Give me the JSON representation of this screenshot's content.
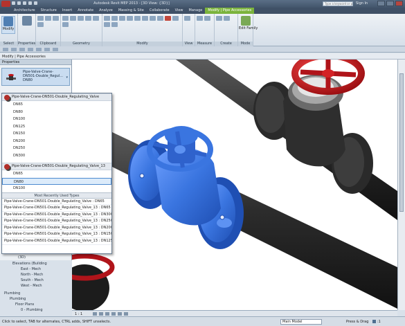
{
  "window": {
    "title": "Autodesk Revit MEP 2013 - [3D View: {3D}]",
    "help_search_placeholder": "Type a keyword or phrase",
    "signin_label": "Sign In"
  },
  "ribbon_tabs": [
    "Architecture",
    "Structure",
    "Insert",
    "Annotate",
    "Analyze",
    "Massing & Site",
    "Collaborate",
    "View",
    "Manage",
    "Modify | Pipe Accessories"
  ],
  "ribbon_panels": {
    "select": "Select",
    "properties": "Properties",
    "clipboard": "Clipboard",
    "geometry": "Geometry",
    "modify": "Modify",
    "view": "View",
    "measure": "Measure",
    "create": "Create",
    "mode": "Mode",
    "modify_button": "Modify",
    "edit_family_button": "Edit Family"
  },
  "context_label": "Modify | Pipe Accessories",
  "properties": {
    "header": "Properties",
    "type_selector": "Pipe-Valve-Crane-DN501-Double_Regul... DN80",
    "dropdown_arrow": "▾"
  },
  "type_dropdown": {
    "families": [
      {
        "name": "Pipe-Valve-Crane-DN501-Double_Regulating_Valve",
        "sizes": [
          "DN65",
          "DN80",
          "DN100",
          "DN125",
          "DN150",
          "DN200",
          "DN250",
          "DN300"
        ]
      },
      {
        "name": "Pipe-Valve-Crane-DN501-Double_Regulating_Valve_13",
        "sizes": [
          "DN65",
          "DN80",
          "DN100"
        ]
      }
    ],
    "mru_header": "Most Recently Used Types",
    "mru_items": [
      "Pipe-Valve-Crane-DN501-Double_Regulating_Valve : DN65",
      "Pipe-Valve-Crane-DN501-Double_Regulating_Valve_13 : DN65",
      "Pipe-Valve-Crane-DN501-Double_Regulating_Valve_13 : DN300",
      "Pipe-Valve-Crane-DN501-Double_Regulating_Valve_13 : DN250",
      "Pipe-Valve-Crane-DN501-Double_Regulating_Valve_13 : DN200",
      "Pipe-Valve-Crane-DN501-Double_Regulating_Valve_13 : DN150",
      "Pipe-Valve-Crane-DN501-Double_Regulating_Valve_13 : DN125"
    ]
  },
  "browser_tree": {
    "items": [
      "(3D)",
      "Elevations (Building",
      "East - Mech",
      "North - Mech",
      "South - Mech",
      "West - Mech",
      "Plumbing",
      "Plumbing",
      "Floor Plans",
      "0 - Plumbing"
    ]
  },
  "view_control": {
    "scale": "1 : 1"
  },
  "status": {
    "message": "Click to select, TAB for alternates, CTRL adds, SHIFT unselects.",
    "workset": "Main Model",
    "press_drag": "Press & Drag",
    "filter_count": ":1"
  },
  "colors": {
    "accent_context_tab": "#7bb33c",
    "valve_selected": "#3a75e0",
    "handwheel": "#c0161b",
    "pipe": "#3a3a3a"
  }
}
